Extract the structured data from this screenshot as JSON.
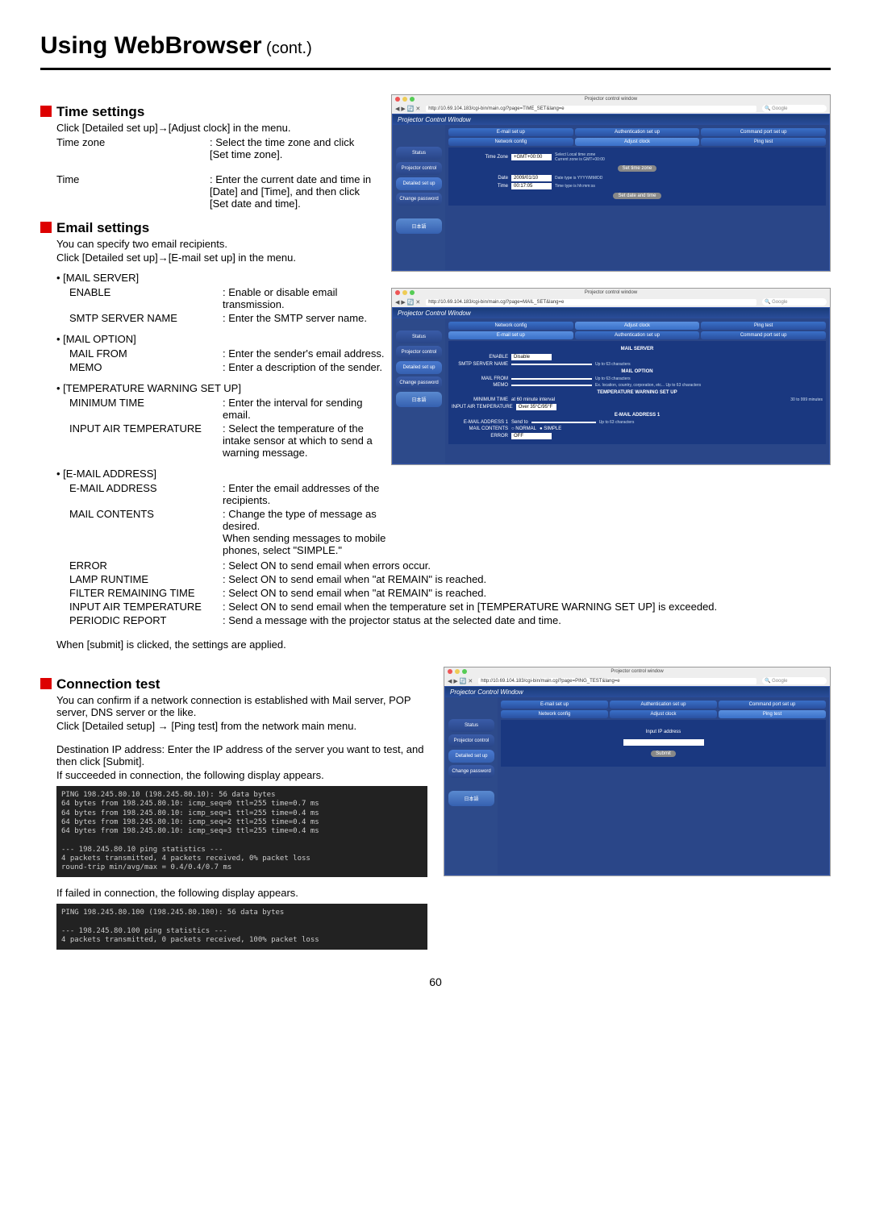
{
  "page": {
    "title": "Using WebBrowser",
    "title_cont": " (cont.)",
    "number": "60"
  },
  "time_settings": {
    "heading": "Time settings",
    "intro": "Click [Detailed set up]→[Adjust clock] in the menu.",
    "items": [
      {
        "label": "Time zone",
        "value": ": Select the time zone and click [Set time zone]."
      },
      {
        "label": "Time",
        "value": ": Enter the current date and time in [Date] and [Time], and then click [Set date and time]."
      }
    ]
  },
  "email_settings": {
    "heading": "Email settings",
    "intro1": "You can specify two email recipients.",
    "intro2": "Click [Detailed set up]→[E-mail set up] in the menu.",
    "groups": [
      {
        "bullet": "• [MAIL SERVER]",
        "items": [
          {
            "label": "ENABLE",
            "value": ": Enable or disable email transmission."
          },
          {
            "label": "SMTP SERVER NAME",
            "value": ": Enter the SMTP server name."
          }
        ]
      },
      {
        "bullet": "• [MAIL OPTION]",
        "items": [
          {
            "label": "MAIL FROM",
            "value": ": Enter the sender's email address."
          },
          {
            "label": "MEMO",
            "value": ": Enter a description of the sender."
          }
        ]
      },
      {
        "bullet": "• [TEMPERATURE WARNING SET UP]",
        "items": [
          {
            "label": "MINIMUM TIME",
            "value": ": Enter the interval for sending email."
          },
          {
            "label": "INPUT AIR TEMPERATURE",
            "value": ": Select the temperature of the intake sensor at which to send a warning message."
          }
        ]
      },
      {
        "bullet": "• [E-MAIL ADDRESS]",
        "items": [
          {
            "label": "E-MAIL ADDRESS",
            "value": ": Enter the email addresses of the recipients."
          },
          {
            "label": "MAIL CONTENTS",
            "value": ": Change the type of message as desired.\nWhen sending messages to mobile phones, select \"SIMPLE.\""
          },
          {
            "label": "ERROR",
            "value": ": Select ON to send email when errors occur."
          },
          {
            "label": "LAMP RUNTIME",
            "value": ": Select ON to send email when \"at REMAIN\" is reached."
          },
          {
            "label": "FILTER REMAINING TIME",
            "value": ": Select ON to send email when \"at REMAIN\" is reached."
          },
          {
            "label": "INPUT AIR TEMPERATURE",
            "value": ": Select ON to send email when the temperature set in [TEMPERATURE WARNING SET UP] is exceeded."
          },
          {
            "label": "PERIODIC REPORT",
            "value": ": Send a message with the projector status at the selected date and time."
          }
        ]
      }
    ],
    "footer": "When [submit] is clicked, the settings are applied."
  },
  "connection_test": {
    "heading": "Connection test",
    "p1": "You can confirm if a network connection is established with Mail server, POP server, DNS server or the like.",
    "p2": "Click [Detailed setup] → [Ping test] from the network main menu.",
    "p3": "Destination IP address: Enter the IP address of the server you want to test, and then click [Submit].",
    "p4": "If succeeded in connection, the following display appears.",
    "ping_ok": "PING 198.245.80.10 (198.245.80.10): 56 data bytes\n64 bytes from 198.245.80.10: icmp_seq=0 ttl=255 time=0.7 ms\n64 bytes from 198.245.80.10: icmp_seq=1 ttl=255 time=0.4 ms\n64 bytes from 198.245.80.10: icmp_seq=2 ttl=255 time=0.4 ms\n64 bytes from 198.245.80.10: icmp_seq=3 ttl=255 time=0.4 ms\n\n--- 198.245.80.10 ping statistics ---\n4 packets transmitted, 4 packets received, 0% packet loss\nround-trip min/avg/max = 0.4/0.4/0.7 ms",
    "p5": "If failed in connection, the following display appears.",
    "ping_ng": "PING 198.245.80.100 (198.245.80.100): 56 data bytes\n\n--- 198.245.80.100 ping statistics ---\n4 packets transmitted, 0 packets received, 100% packet loss"
  },
  "shot": {
    "window_title": "Projector control window",
    "url_time": "http://10.69.104.183/cgi-bin/main.cgi?page=TIME_SET&lang=e",
    "url_mail": "http://10.69.104.183/cgi-bin/main.cgi?page=MAIL_SET&lang=e",
    "url_ping": "http://10.69.104.183/cgi-bin/main.cgi?page=PING_TEST&lang=e",
    "search": "Google",
    "pcw_header": "Projector Control Window",
    "side": {
      "status": "Status",
      "projector": "Projector control",
      "detailed": "Detailed set up",
      "change": "Change password",
      "jp": "日本語"
    },
    "tabs": {
      "email": "E-mail set up",
      "auth": "Authentication set up",
      "command": "Command port set up",
      "network": "Network config",
      "adjust": "Adjust clock",
      "ping": "Ping test"
    },
    "time": {
      "tz_label": "Time Zone",
      "tz_val": "+GMT+00:00",
      "tz_note1": "Select Local time zone",
      "tz_note2": "Current zone is GMT+00:00",
      "tz_btn": "Set time zone",
      "date_label": "Date",
      "date_val": "2009/01/10",
      "date_note": "Date type is YYYY/MM/DD",
      "time_label": "Time",
      "time_val": "00:17:05",
      "time_note": "Time type is hh:mm:ss",
      "set_btn": "Set date and time"
    },
    "mail": {
      "sec_server": "MAIL SERVER",
      "enable": "ENABLE",
      "enable_val": "Disable",
      "smtp": "SMTP SERVER NAME",
      "smtp_note": "Up to 63 characters",
      "sec_option": "MAIL OPTION",
      "mailfrom": "MAIL FROM",
      "mailfrom_note": "Up to 63 characters",
      "memo": "MEMO",
      "memo_note": "Ex. location, country, corporation, etc... Up to 63 characters",
      "sec_temp": "TEMPERATURE WARNING SET UP",
      "mintime": "MINIMUM TIME",
      "mintime_val": "at 60 minute interval",
      "mintime_note": "30 to 999 minutes",
      "iat": "INPUT AIR TEMPERATURE",
      "iat_val": "Over 35°C/95°F",
      "sec_addr": "E-MAIL ADDRESS 1",
      "addr1": "E-MAIL ADDRESS 1",
      "sendto": "Send to",
      "addr_note": "Up to 63 characters",
      "contents": "MAIL CONTENTS",
      "normal": "NORMAL",
      "simple": "SIMPLE",
      "error": "ERROR",
      "off": "OFF"
    },
    "ping": {
      "inp": "Input IP address",
      "submit": "Submit"
    }
  }
}
